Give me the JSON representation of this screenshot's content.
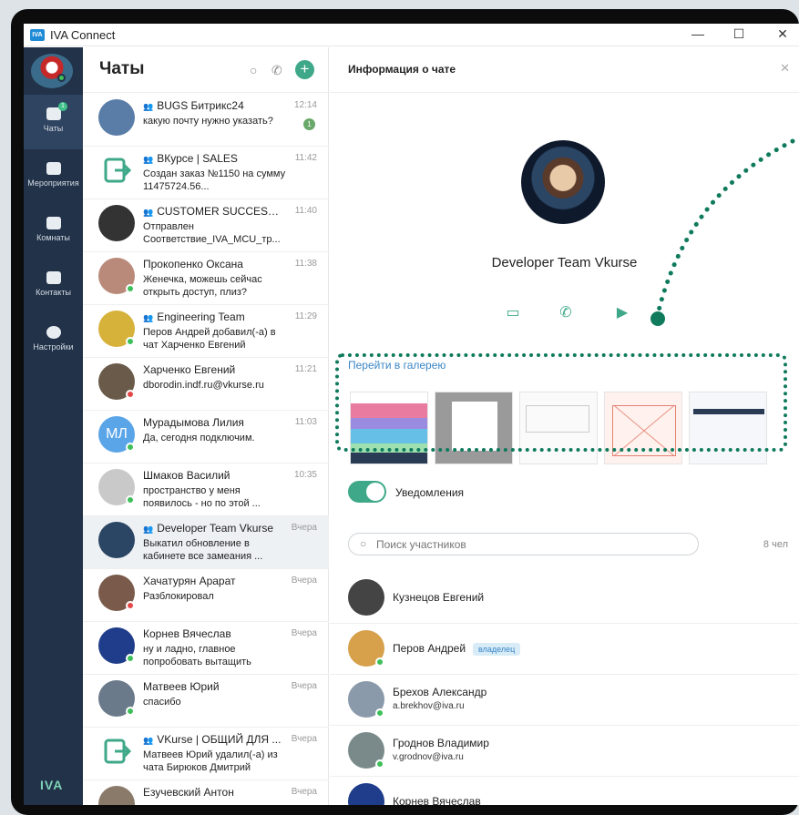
{
  "window": {
    "title": "IVA Connect",
    "logo": "IVA",
    "minimize": "—",
    "maximize": "☐",
    "close": "✕"
  },
  "rail": {
    "items": [
      {
        "label": "Чаты",
        "badge": "1"
      },
      {
        "label": "Мероприятия"
      },
      {
        "label": "Комнаты"
      },
      {
        "label": "Контакты"
      },
      {
        "label": "Настройки"
      }
    ],
    "footer": "IVA"
  },
  "chat_list": {
    "title": "Чаты",
    "add_label": "+",
    "chats": [
      {
        "name": "BUGS Битрикс24",
        "group": true,
        "time": "12:14",
        "message": "какую почту нужно указать?",
        "unread": "1"
      },
      {
        "name": "ВКурсе | SALES",
        "group": true,
        "time": "11:42",
        "message": "Создан заказ №1150 на сумму 11475724.56..."
      },
      {
        "name": "CUSTOMER SUCCESS | ...",
        "group": true,
        "time": "11:40",
        "message": "Отправлен Соответствие_IVA_MCU_тр..."
      },
      {
        "name": "Прокопенко Оксана",
        "group": false,
        "time": "11:38",
        "message": "Женечка, можешь сейчас открыть доступ, плиз?"
      },
      {
        "name": "Engineering Team",
        "group": true,
        "time": "11:29",
        "message": "Перов Андрей добавил(-а) в чат Харченко Евгений"
      },
      {
        "name": "Харченко Евгений",
        "group": false,
        "time": "11:21",
        "message": "dborodin.indf.ru@vkurse.ru"
      },
      {
        "name": "Мурадымова Лилия",
        "group": false,
        "time": "11:03",
        "message": "Да, сегодня подключим.",
        "initials": "МЛ"
      },
      {
        "name": "Шмаков Василий",
        "group": false,
        "time": "10:35",
        "message": "пространство у меня появилось - но по этой ..."
      },
      {
        "name": "Developer Team Vkurse",
        "group": true,
        "time": "Вчера",
        "message": "Выкатил обновление в кабинете все замеания ..."
      },
      {
        "name": "Хачатурян Арарат",
        "group": false,
        "time": "Вчера",
        "message": "Разблокировал"
      },
      {
        "name": "Корнев Вячеслав",
        "group": false,
        "time": "Вчера",
        "message": "ну и ладно, главное попробовать вытащить"
      },
      {
        "name": "Матвеев Юрий",
        "group": false,
        "time": "Вчера",
        "message": "спасибо"
      },
      {
        "name": "VKurse | ОБЩИЙ ДЛЯ ...",
        "group": true,
        "time": "Вчера",
        "message": "Матвеев Юрий удалил(-а) из чата Бирюков Дмитрий"
      },
      {
        "name": "Езучевский Антон",
        "group": false,
        "time": "Вчера",
        "message": ""
      }
    ]
  },
  "panel": {
    "title": "Информация о чате",
    "chat_name": "Developer Team Vkurse",
    "gallery_link": "Перейти в галерею",
    "notifications_label": "Уведомления",
    "search_placeholder": "Поиск участников",
    "member_count": "8 чел",
    "members": [
      {
        "name": "Кузнецов Евгений",
        "email": ""
      },
      {
        "name": "Перов Андрей",
        "email": "",
        "badge": "владелец"
      },
      {
        "name": "Брехов Александр",
        "email": "a.brekhov@iva.ru"
      },
      {
        "name": "Гроднов Владимир",
        "email": "v.grodnov@iva.ru"
      },
      {
        "name": "Корнев Вячеслав",
        "email": ""
      }
    ]
  },
  "colors": {
    "accent": "#3fa888",
    "rail": "#213249",
    "link": "#3b86c6",
    "annotation": "#0f7a5c"
  }
}
